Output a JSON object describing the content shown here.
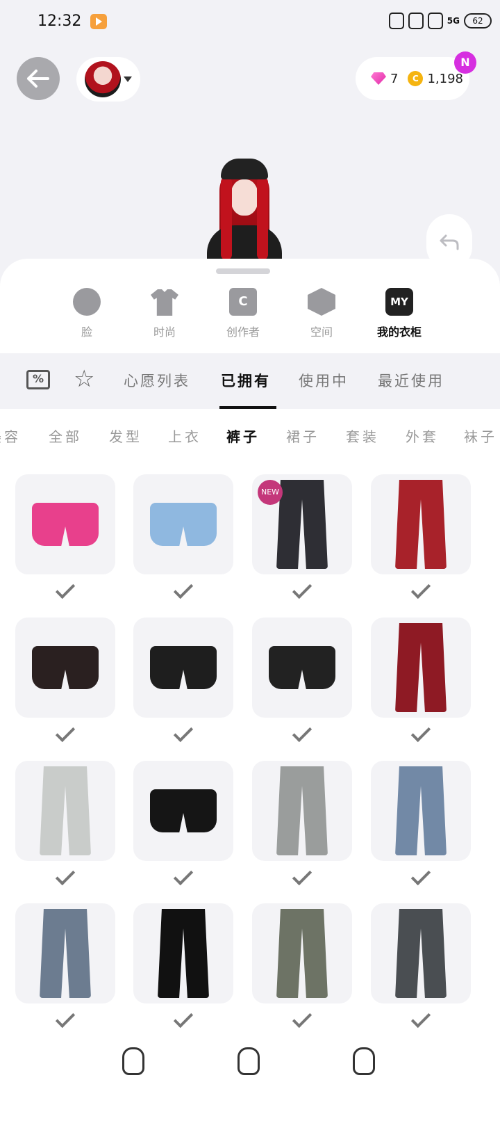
{
  "status_bar": {
    "time": "12:32",
    "signal": "5G",
    "battery": "62"
  },
  "header": {
    "currency": {
      "gems": "7",
      "coins": "1,198",
      "coin_symbol": "C"
    },
    "notification_badge": "N"
  },
  "categories": [
    {
      "label": "脸",
      "icon": "face-icon"
    },
    {
      "label": "时尚",
      "icon": "shirt-icon"
    },
    {
      "label": "创作者",
      "icon": "creator-bag-icon",
      "glyph": "C"
    },
    {
      "label": "空间",
      "icon": "cube-icon"
    },
    {
      "label": "我的衣柜",
      "icon": "my-closet-icon",
      "glyph": "MY",
      "active": true
    }
  ],
  "list_tabs": [
    {
      "label": "心愿列表"
    },
    {
      "label": "已拥有",
      "active": true
    },
    {
      "label": "使用中"
    },
    {
      "label": "最近使用"
    }
  ],
  "sub_tabs": [
    {
      "label": "美容"
    },
    {
      "label": "全部"
    },
    {
      "label": "发型"
    },
    {
      "label": "上衣"
    },
    {
      "label": "裤子",
      "active": true
    },
    {
      "label": "裙子"
    },
    {
      "label": "套装"
    },
    {
      "label": "外套"
    },
    {
      "label": "袜子"
    }
  ],
  "items": [
    {
      "name": "pink-plaid-shorts-with-stockings",
      "color": "#e8408c",
      "owned": true
    },
    {
      "name": "light-denim-shorts",
      "color": "#8fb8e0",
      "owned": true
    },
    {
      "name": "dark-flared-jeans",
      "color": "#2e2e34",
      "owned": true,
      "badge": "NEW"
    },
    {
      "name": "red-plaid-cargo-pants",
      "color": "#a8222a",
      "owned": true
    },
    {
      "name": "black-satin-shorts",
      "color": "#2a2020",
      "owned": true
    },
    {
      "name": "black-shorts-white-bow",
      "color": "#1e1e1e",
      "owned": true
    },
    {
      "name": "black-ruffle-shorts",
      "color": "#222222",
      "owned": true
    },
    {
      "name": "red-track-pants",
      "color": "#8e1a24",
      "owned": true
    },
    {
      "name": "spider-print-baggy-jeans",
      "color": "#c9ccca",
      "owned": true
    },
    {
      "name": "black-tiered-ruffle-skort",
      "color": "#151515",
      "owned": true
    },
    {
      "name": "washed-grey-baggy-jeans",
      "color": "#9a9d9c",
      "owned": true
    },
    {
      "name": "blue-baggy-jeans",
      "color": "#7289a6",
      "owned": true
    },
    {
      "name": "faded-flared-jeans",
      "color": "#6c7c90",
      "owned": true
    },
    {
      "name": "black-flared-pants",
      "color": "#111111",
      "owned": true
    },
    {
      "name": "wrap-skirt-over-pants",
      "color": "#6d7365",
      "owned": true
    },
    {
      "name": "grey-washed-flared-jeans",
      "color": "#4a4e52",
      "owned": true
    }
  ]
}
